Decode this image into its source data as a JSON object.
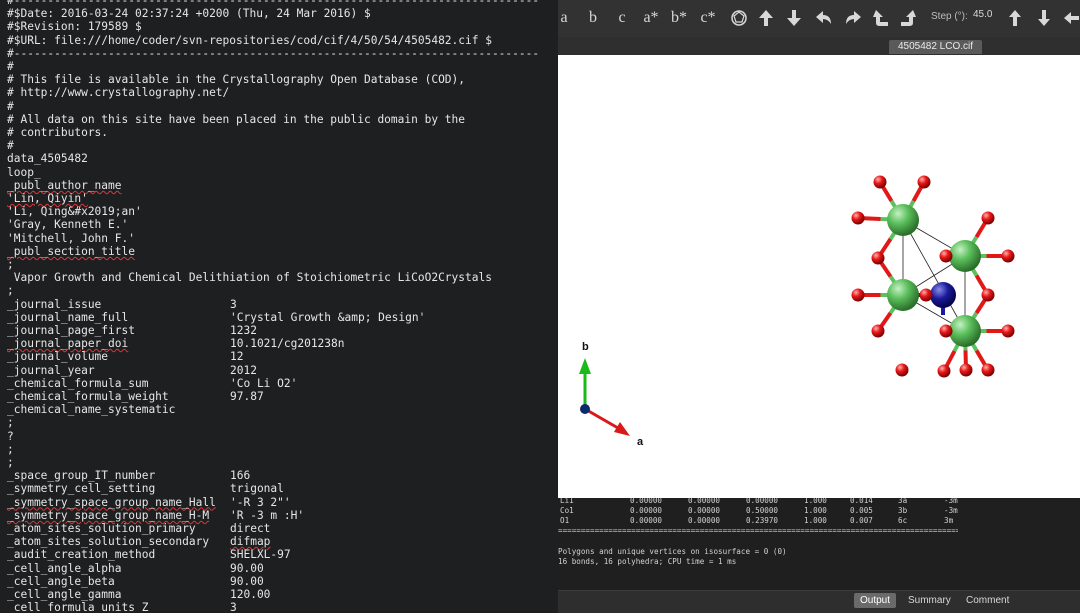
{
  "editor": {
    "separator": "#------------------------------------------------------------------------------",
    "header_lines": [
      "#$Date: 2016-03-24 02:37:24 +0200 (Thu, 24 Mar 2016) $",
      "#$Revision: 179589 $",
      "#$URL: file:///home/coder/svn-repositories/cod/cif/4/50/54/4505482.cif $"
    ],
    "comment_lines": [
      "#",
      "# This file is available in the Crystallography Open Database (COD),",
      "# http://www.crystallography.net/",
      "#",
      "# All data on this site have been placed in the public domain by the",
      "# contributors.",
      "#"
    ],
    "data_block": "data_4505482",
    "loop_kw": "loop_",
    "author_key": "_publ_author_name",
    "authors": [
      "'Lin, Qiyin'",
      "'Li, Qing&#x2019;an'",
      "'Gray, Kenneth E.'",
      "'Mitchell, John F.'"
    ],
    "title_key": "_publ_section_title",
    "semicolon": ";",
    "title_text": " Vapor Growth and Chemical Delithiation of Stoichiometric LiCoO2Crystals",
    "journal": [
      {
        "k": "_journal_issue",
        "v": "3"
      },
      {
        "k": "_journal_name_full",
        "v": "'Crystal Growth &amp; Design'"
      },
      {
        "k": "_journal_page_first",
        "v": "1232"
      },
      {
        "k": "_journal_paper_doi",
        "v": "10.1021/cg201238n"
      },
      {
        "k": "_journal_volume",
        "v": "12"
      },
      {
        "k": "_journal_year",
        "v": "2012"
      },
      {
        "k": "_chemical_formula_sum",
        "v": "'Co Li O2'"
      },
      {
        "k": "_chemical_formula_weight",
        "v": "97.87"
      },
      {
        "k": "_chemical_name_systematic",
        "v": ""
      }
    ],
    "mid_lines": [
      ";",
      "?",
      ";"
    ],
    "params": [
      {
        "k": "_space_group_IT_number",
        "v": "166"
      },
      {
        "k": "_symmetry_cell_setting",
        "v": "trigonal"
      },
      {
        "k": "_symmetry_space_group_name_Hall",
        "v": "'-R 3 2\"'"
      },
      {
        "k": "_symmetry_space_group_name_H-M",
        "v": "'R -3 m :H'"
      },
      {
        "k": "_atom_sites_solution_primary",
        "v": "direct"
      },
      {
        "k": "_atom_sites_solution_secondary",
        "v": "difmap"
      },
      {
        "k": "_audit_creation_method",
        "v": "SHELXL-97"
      },
      {
        "k": "_cell_angle_alpha",
        "v": "90.00"
      },
      {
        "k": "_cell_angle_beta",
        "v": "90.00"
      },
      {
        "k": "_cell_angle_gamma",
        "v": "120.00"
      },
      {
        "k": "_cell_formula_units_Z",
        "v": "3"
      }
    ]
  },
  "toolbar": {
    "buttons": [
      "a",
      "b",
      "c",
      "a*",
      "b*",
      "c*"
    ],
    "icons": [
      "polyhedron-view-icon",
      "rotate-up-icon",
      "rotate-down-icon",
      "rotate-left-icon",
      "rotate-right-icon",
      "rotate-ccw-icon",
      "rotate-cw-icon",
      "step-up-icon",
      "step-down-icon",
      "back-arrow-icon"
    ],
    "step_label": "Step (°):",
    "step_value": "45.0"
  },
  "file_tab": "4505482 LCO.cif",
  "viewer": {
    "axis_b_label": "b",
    "axis_a_label": "a",
    "colors": {
      "cobalt": "#4aa64a",
      "oxygen": "#e01010",
      "lithium": "#1a1a9a",
      "axis_b": "#1aba1a",
      "axis_a": "#d81a1a"
    }
  },
  "console": {
    "rows": [
      {
        "name": "Li1",
        "c1": "0.00000",
        "c2": "0.00000",
        "c3": "0.00000",
        "occ": "1.000",
        "u": "0.014",
        "site": "3a",
        "sym": "-3m"
      },
      {
        "name": "Co1",
        "c1": "0.00000",
        "c2": "0.00000",
        "c3": "0.50000",
        "occ": "1.000",
        "u": "0.005",
        "site": "3b",
        "sym": "-3m"
      },
      {
        "name": "O1",
        "c1": "0.00000",
        "c2": "0.00000",
        "c3": "0.23970",
        "occ": "1.000",
        "u": "0.007",
        "site": "6c",
        "sym": "3m"
      }
    ],
    "separator": "==============================================================================================================================",
    "message1": "Polygons and unique vertices on isosurface = 0 (0)",
    "message2": "16 bonds, 16 polyhedra; CPU time = 1 ms"
  },
  "bottom_tabs": [
    "Output",
    "Summary",
    "Comment"
  ]
}
